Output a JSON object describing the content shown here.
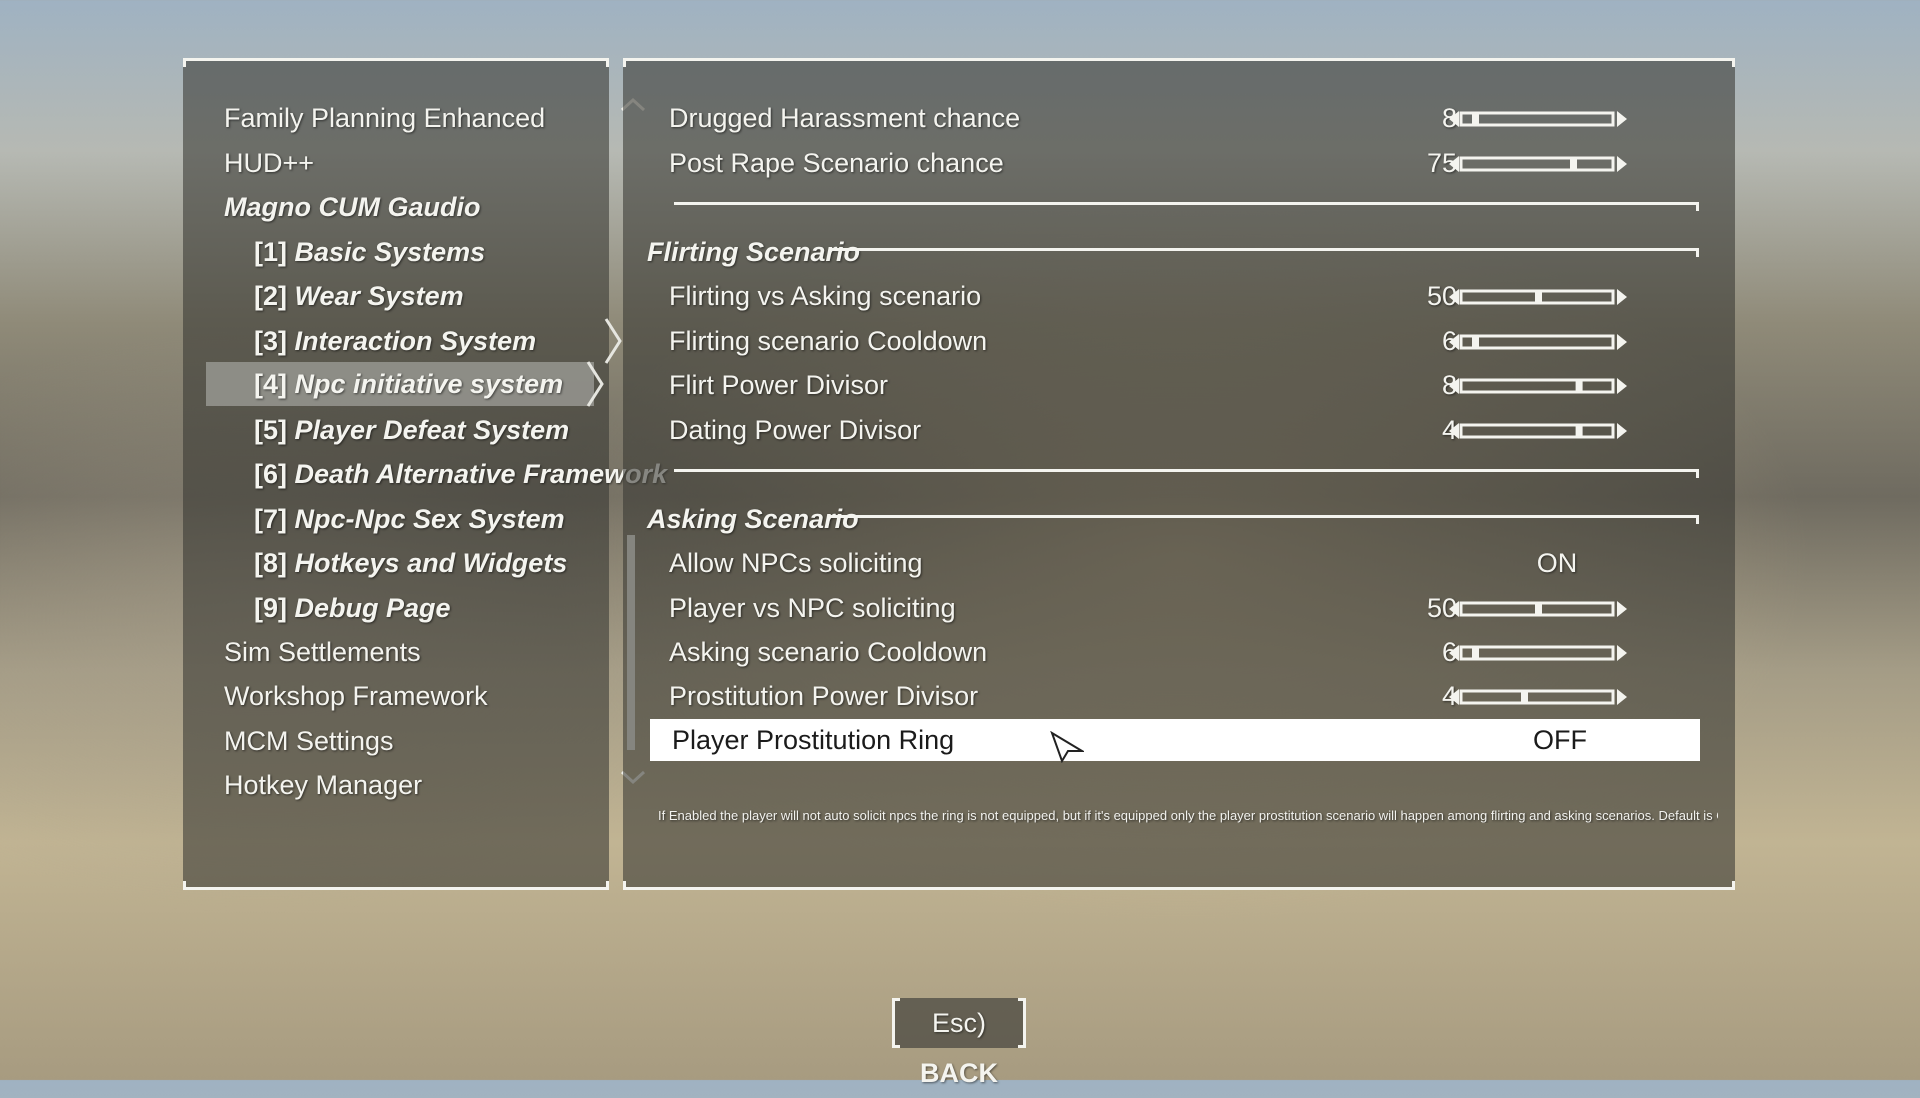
{
  "sidebar": {
    "items": [
      {
        "label": "Family Planning Enhanced"
      },
      {
        "label": "HUD++"
      },
      {
        "label": "Magno CUM Gaudio"
      },
      {
        "num": "[1]",
        "label": "Basic Systems"
      },
      {
        "num": "[2]",
        "label": "Wear System"
      },
      {
        "num": "[3]",
        "label": "Interaction System"
      },
      {
        "num": "[4]",
        "label": "Npc initiative system"
      },
      {
        "num": "[5]",
        "label": "Player Defeat System"
      },
      {
        "num": "[6]",
        "label": "Death Alternative Framework"
      },
      {
        "num": "[7]",
        "label": "Npc-Npc Sex System"
      },
      {
        "num": "[8]",
        "label": "Hotkeys and Widgets"
      },
      {
        "num": "[9]",
        "label": "Debug Page"
      },
      {
        "label": "Sim Settlements"
      },
      {
        "label": "Workshop Framework"
      },
      {
        "label": "MCM Settings"
      },
      {
        "label": "Hotkey Manager"
      }
    ],
    "selected_index": 6
  },
  "settings": {
    "top_rows": [
      {
        "label": "Drugged Harassment chance",
        "value": "8",
        "slider_fraction": 0.05
      },
      {
        "label": "Post Rape Scenario chance",
        "value": "75",
        "slider_fraction": 0.75
      }
    ],
    "flirting": {
      "title": "Flirting Scenario",
      "rows": [
        {
          "label": "Flirting vs Asking scenario",
          "value": "50",
          "slider_fraction": 0.5
        },
        {
          "label": "Flirting scenario Cooldown",
          "value": "6",
          "slider_fraction": 0.05
        },
        {
          "label": "Flirt Power Divisor",
          "value": "8",
          "slider_fraction": 0.79
        },
        {
          "label": "Dating Power Divisor",
          "value": "4",
          "slider_fraction": 0.79
        }
      ]
    },
    "asking": {
      "title": "Asking Scenario",
      "rows": [
        {
          "label": "Allow NPCs soliciting",
          "toggle": "ON"
        },
        {
          "label": "Player vs NPC soliciting",
          "value": "50",
          "slider_fraction": 0.5
        },
        {
          "label": "Asking scenario Cooldown",
          "value": "6",
          "slider_fraction": 0.05
        },
        {
          "label": "Prostitution Power Divisor",
          "value": "4",
          "slider_fraction": 0.4
        },
        {
          "label": "Player Prostitution Ring",
          "toggle": "OFF"
        }
      ]
    },
    "help_text": "If Enabled the player will not auto solicit npcs the ring is not equipped, but if it's equipped only the player prostitution scenario will happen among flirting and asking scenarios. Default is OFF"
  },
  "footer": {
    "key": "Esc)",
    "back_label": "BACK"
  },
  "colors": {
    "accent": "#f4f4ef",
    "selected_bg": "#96968f",
    "highlight_bg": "#ffffff"
  }
}
